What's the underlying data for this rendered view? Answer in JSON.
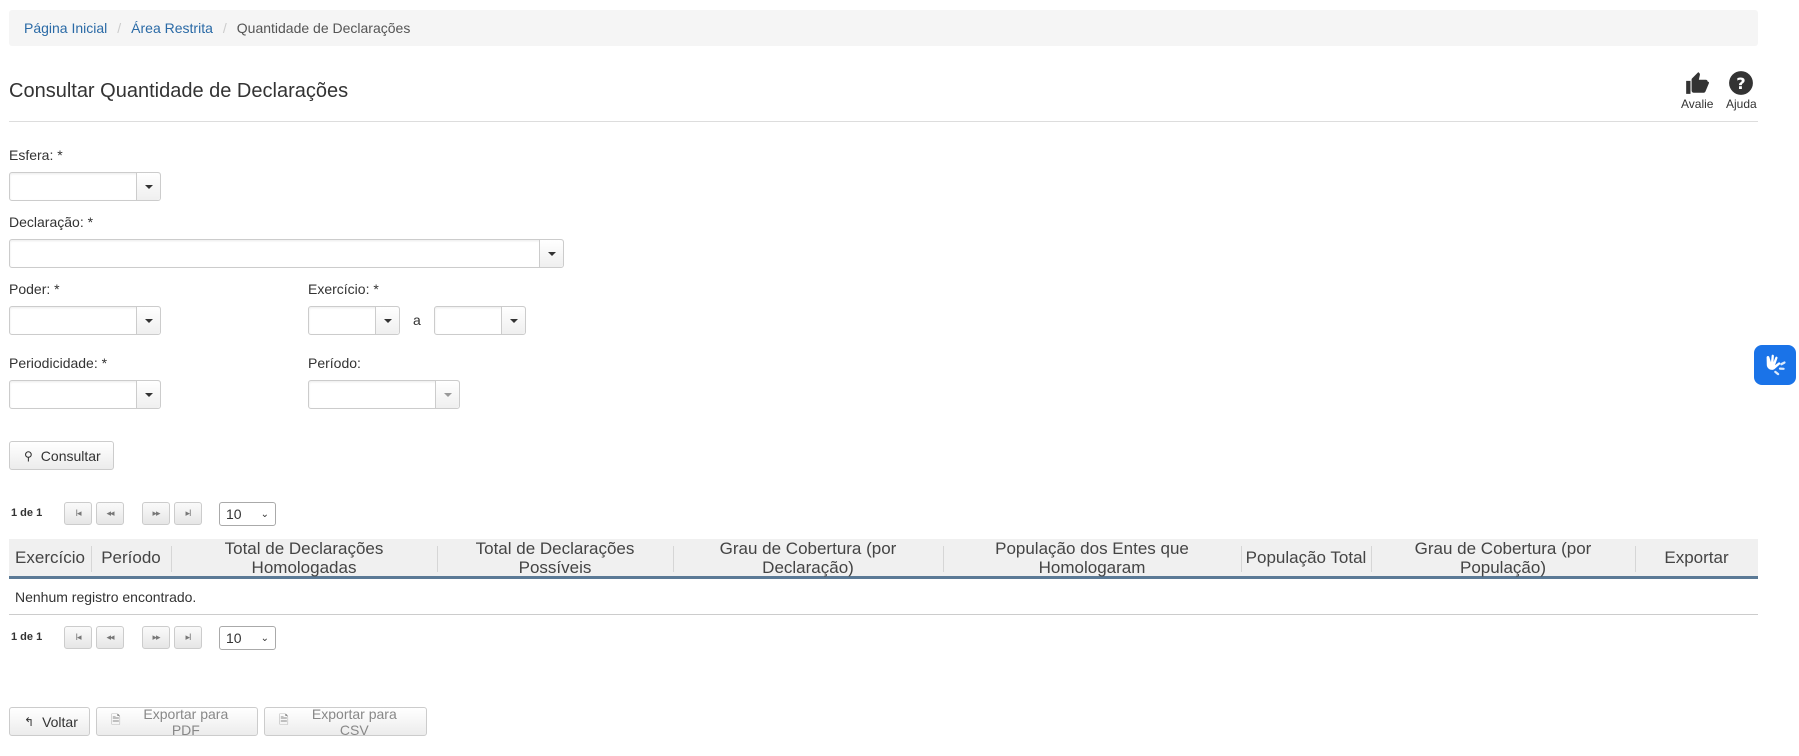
{
  "breadcrumb": {
    "home": "Página Inicial",
    "restricted": "Área Restrita",
    "current": "Quantidade de Declarações"
  },
  "page_title": "Consultar Quantidade de Declarações",
  "top_actions": {
    "rate": "Avalie",
    "help": "Ajuda"
  },
  "form": {
    "esfera_label": "Esfera: *",
    "declaracao_label": "Declaração: *",
    "poder_label": "Poder: *",
    "exercicio_label": "Exercício: *",
    "exercicio_sep": "a",
    "periodicidade_label": "Periodicidade: *",
    "periodo_label": "Período:",
    "consultar": "Consultar"
  },
  "pagination": {
    "page_info": "1 de 1",
    "first": "I◂",
    "prev": "◂◂",
    "next": "▸▸",
    "last": "▸I",
    "rows": "10"
  },
  "table": {
    "columns": [
      "Exercício",
      "Período",
      "Total de Declarações Homologadas",
      "Total de Declarações Possíveis",
      "Grau de Cobertura (por Declaração)",
      "População dos Entes que Homologaram",
      "População Total",
      "Grau de Cobertura (por População)",
      "Exportar"
    ],
    "empty_message": "Nenhum registro encontrado."
  },
  "actions": {
    "back": "Voltar",
    "export_pdf": "Exportar para PDF",
    "export_csv": "Exportar para CSV"
  },
  "colors": {
    "link": "#2a6aa6",
    "header_border": "#5b7a96",
    "accessibility": "#1a73e8"
  }
}
